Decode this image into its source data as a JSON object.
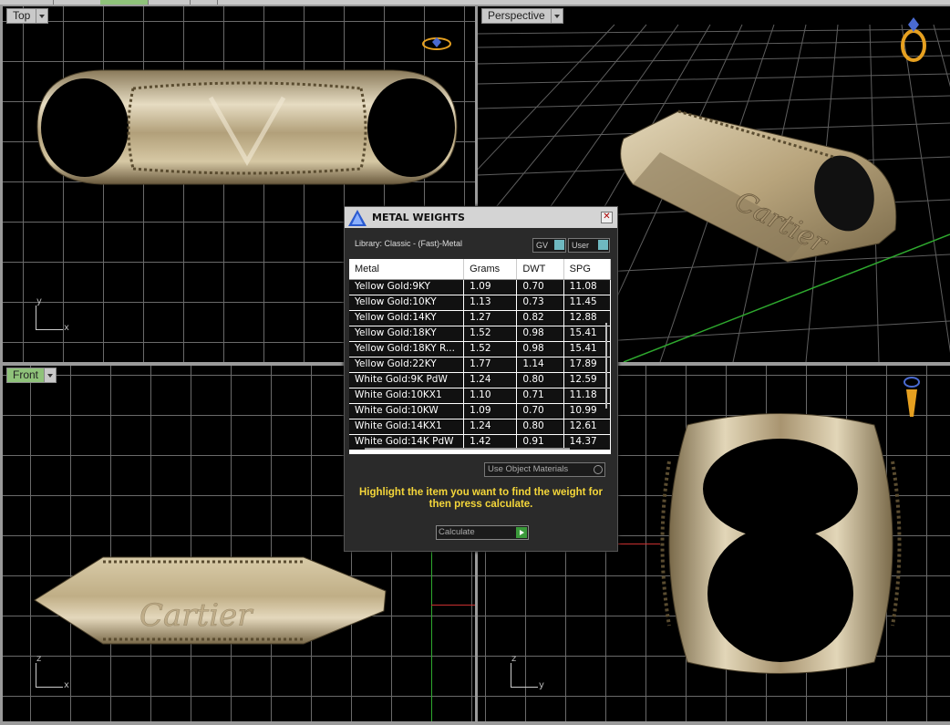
{
  "viewports": {
    "top": {
      "label": "Top"
    },
    "perspective": {
      "label": "Perspective"
    },
    "front": {
      "label": "Front"
    },
    "right": {
      "label": ""
    }
  },
  "axes": {
    "top": {
      "a": "y",
      "b": "x"
    },
    "front": {
      "a": "z",
      "b": "x"
    },
    "right": {
      "a": "z",
      "b": "y"
    }
  },
  "engraving": "Cartier",
  "dialog": {
    "title": "METAL WEIGHTS",
    "close": "✕",
    "library_label": "Library: Classic - (Fast)-Metal",
    "toggle_gv": "GV",
    "toggle_user": "User",
    "columns": [
      "Metal",
      "Grams",
      "DWT",
      "SPG"
    ],
    "rows": [
      [
        "Yellow Gold:9KY",
        "1.09",
        "0.70",
        "11.08"
      ],
      [
        "Yellow Gold:10KY",
        "1.13",
        "0.73",
        "11.45"
      ],
      [
        "Yellow Gold:14KY",
        "1.27",
        "0.82",
        "12.88"
      ],
      [
        "Yellow Gold:18KY",
        "1.52",
        "0.98",
        "15.41"
      ],
      [
        "Yellow Gold:18KY R...",
        "1.52",
        "0.98",
        "15.41"
      ],
      [
        "Yellow Gold:22KY",
        "1.77",
        "1.14",
        "17.89"
      ],
      [
        "White Gold:9K PdW",
        "1.24",
        "0.80",
        "12.59"
      ],
      [
        "White Gold:10KX1",
        "1.10",
        "0.71",
        "11.18"
      ],
      [
        "White Gold:10KW",
        "1.09",
        "0.70",
        "10.99"
      ],
      [
        "White Gold:14KX1",
        "1.24",
        "0.80",
        "12.61"
      ],
      [
        "White Gold:14K PdW",
        "1.42",
        "0.91",
        "14.37"
      ]
    ],
    "use_object_materials": "Use Object Materials",
    "hint": "Highlight the item you want to find the weight for then press calculate.",
    "calculate": "Calculate"
  },
  "colors": {
    "hint": "#f4d63a",
    "active_viewport": "#8fc27a",
    "metal": "#c8b48a"
  }
}
